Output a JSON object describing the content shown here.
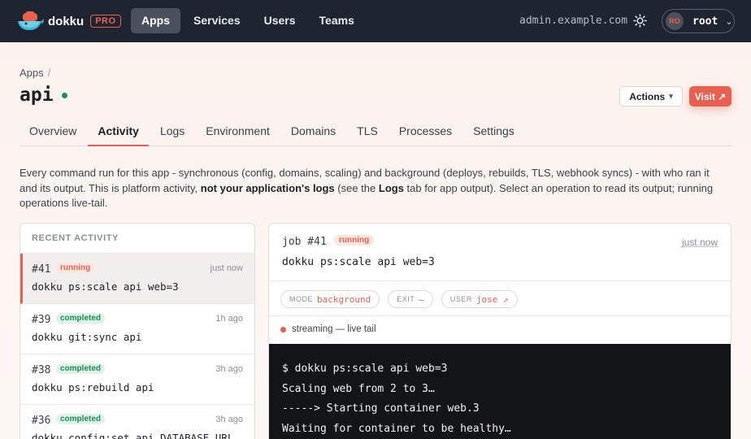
{
  "topbar": {
    "brand": "dokku",
    "pro_badge": "PRO",
    "nav": [
      "Apps",
      "Services",
      "Users",
      "Teams"
    ],
    "host": "admin.example.com",
    "theme_icon": "sun-icon",
    "user_initials": "RO",
    "user_name": "root"
  },
  "breadcrumb": {
    "root": "Apps",
    "separator": "/"
  },
  "app": {
    "name": "api",
    "status_color": "#1f8a56"
  },
  "header_actions": {
    "actions_label": "Actions",
    "visit_label": "Visit ↗"
  },
  "tabs": [
    "Overview",
    "Activity",
    "Logs",
    "Environment",
    "Domains",
    "TLS",
    "Processes",
    "Settings"
  ],
  "description": {
    "part1": "Every command run for this app - synchronous (config, domains, scaling) and background (deploys, rebuilds, TLS, webhook syncs) - with who ran it and its output. This is platform activity, ",
    "bold1": "not your application's logs",
    "part2": " (see the ",
    "bold2": "Logs",
    "part3": " tab for app output). Select an operation to read its output; running operations live-tail."
  },
  "recent": {
    "heading": "RECENT ACTIVITY",
    "items": [
      {
        "id": "#41",
        "status": "running",
        "time": "just now",
        "command": "dokku ps:scale api web=3"
      },
      {
        "id": "#39",
        "status": "completed",
        "time": "1h ago",
        "command": "dokku git:sync api"
      },
      {
        "id": "#38",
        "status": "completed",
        "time": "3h ago",
        "command": "dokku ps:rebuild api"
      },
      {
        "id": "#36",
        "status": "completed",
        "time": "3h ago",
        "command": "dokku config:set api DATABASE_URL"
      }
    ]
  },
  "job": {
    "title": "job #41",
    "status": "running",
    "time": "just now",
    "command": "dokku ps:scale api web=3",
    "mode_label": "MODE",
    "mode_value": "background",
    "exit_label": "EXIT",
    "exit_value": "—",
    "user_label": "USER",
    "user_value": "jose ↗",
    "stream_text": "streaming — live tail",
    "output": [
      "$ dokku ps:scale api web=3",
      "Scaling web from 2 to 3…",
      "-----> Starting container web.3",
      "Waiting for container to be healthy…"
    ]
  },
  "colors": {
    "accent": "#e8604f",
    "topbar": "#1e2430",
    "success": "#1f8a56"
  }
}
